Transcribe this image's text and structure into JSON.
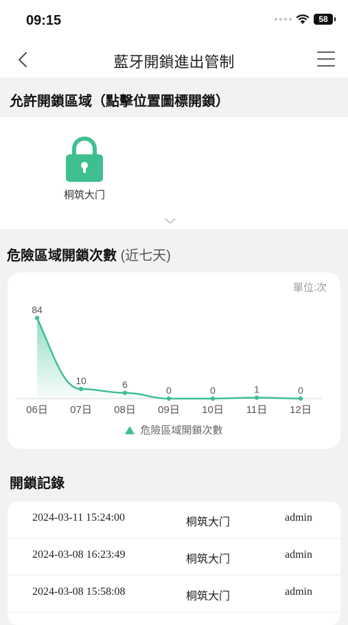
{
  "status_bar": {
    "time": "09:15",
    "battery": "58"
  },
  "nav": {
    "title": "藍牙開鎖進出管制"
  },
  "unlock_section": {
    "title": "允許開鎖區域（點擊位置圖標開鎖）",
    "locations": [
      {
        "label": "桐筑大门",
        "icon": "lock-icon"
      }
    ]
  },
  "chart_section": {
    "title": "危險區域開鎖次數",
    "subtitle": "(近七天)",
    "unit": "單位:次"
  },
  "chart_data": {
    "type": "area",
    "categories": [
      "06日",
      "07日",
      "08日",
      "09日",
      "10日",
      "11日",
      "12日"
    ],
    "series": [
      {
        "name": "危險區域開鎖次數",
        "values": [
          84,
          10,
          6,
          0,
          0,
          1,
          0
        ]
      }
    ],
    "ylim": [
      0,
      90
    ],
    "grid": false,
    "legend": "bottom",
    "colors": {
      "line": "#3fbf8f",
      "fill": "#3fbf8f"
    }
  },
  "records_section": {
    "title": "開鎖記錄",
    "rows": [
      {
        "time": "2024-03-11 15:24:00",
        "location": "桐筑大门",
        "user": "admin"
      },
      {
        "time": "2024-03-08 16:23:49",
        "location": "桐筑大门",
        "user": "admin"
      },
      {
        "time": "2024-03-08 15:58:08",
        "location": "桐筑大门",
        "user": "admin"
      }
    ]
  },
  "colors": {
    "accent": "#3fbf8f",
    "background": "#f2f2f2"
  }
}
